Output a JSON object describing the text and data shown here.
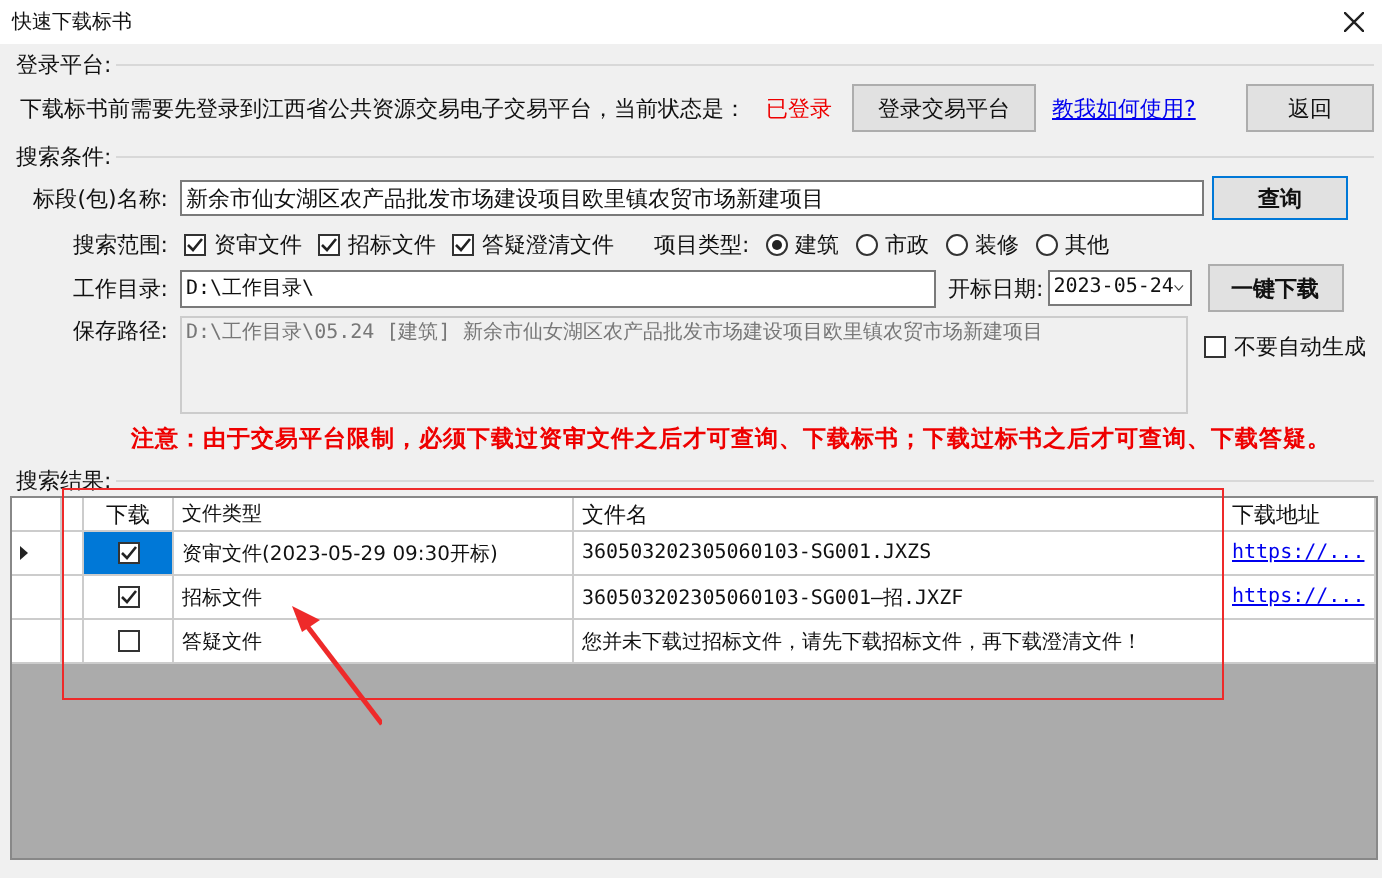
{
  "window": {
    "title": "快速下载标书"
  },
  "login": {
    "legend": "登录平台:",
    "message": "下载标书前需要先登录到江西省公共资源交易电子交易平台，当前状态是：",
    "status": "已登录",
    "login_button": "登录交易平台",
    "help_link": "教我如何使用?",
    "back_button": "返回"
  },
  "search": {
    "legend": "搜索条件:",
    "name_label": "标段(包)名称:",
    "name_value": "新余市仙女湖区农产品批发市场建设项目欧里镇农贸市场新建项目",
    "query_button": "查询",
    "scope_label": "搜索范围:",
    "scopes": [
      {
        "label": "资审文件",
        "checked": true
      },
      {
        "label": "招标文件",
        "checked": true
      },
      {
        "label": "答疑澄清文件",
        "checked": true
      }
    ],
    "type_label": "项目类型:",
    "types": [
      {
        "label": "建筑",
        "selected": true
      },
      {
        "label": "市政",
        "selected": false
      },
      {
        "label": "装修",
        "selected": false
      },
      {
        "label": "其他",
        "selected": false
      }
    ],
    "workdir_label": "工作目录:",
    "workdir_value": "D:\\工作目录\\",
    "date_label": "开标日期:",
    "date_value": "2023-05-24",
    "download_button": "一键下载",
    "save_label": "保存路径:",
    "save_value": "D:\\工作目录\\05.24 [建筑] 新余市仙女湖区农产品批发市场建设项目欧里镇农贸市场新建项目",
    "no_auto": {
      "label": "不要自动生成",
      "checked": false
    },
    "notice": "注意：由于交易平台限制，必须下载过资审文件之后才可查询、下载标书；下载过标书之后才可查询、下载答疑。"
  },
  "results": {
    "legend": "搜索结果:",
    "columns": [
      "下载",
      "文件类型",
      "文件名",
      "下载地址"
    ],
    "rows": [
      {
        "current": true,
        "selected": true,
        "checked": true,
        "type": "资审文件(2023-05-29 09:30开标)",
        "file": "360503202305060103-SG001.JXZS",
        "url": "https://..."
      },
      {
        "current": false,
        "selected": false,
        "checked": true,
        "type": "招标文件",
        "file": "360503202305060103-SG001—招.JXZF",
        "url": "https://..."
      },
      {
        "current": false,
        "selected": false,
        "checked": false,
        "type": "答疑文件",
        "file": "您并未下载过招标文件，请先下载招标文件，再下载澄清文件！",
        "url": ""
      }
    ]
  }
}
